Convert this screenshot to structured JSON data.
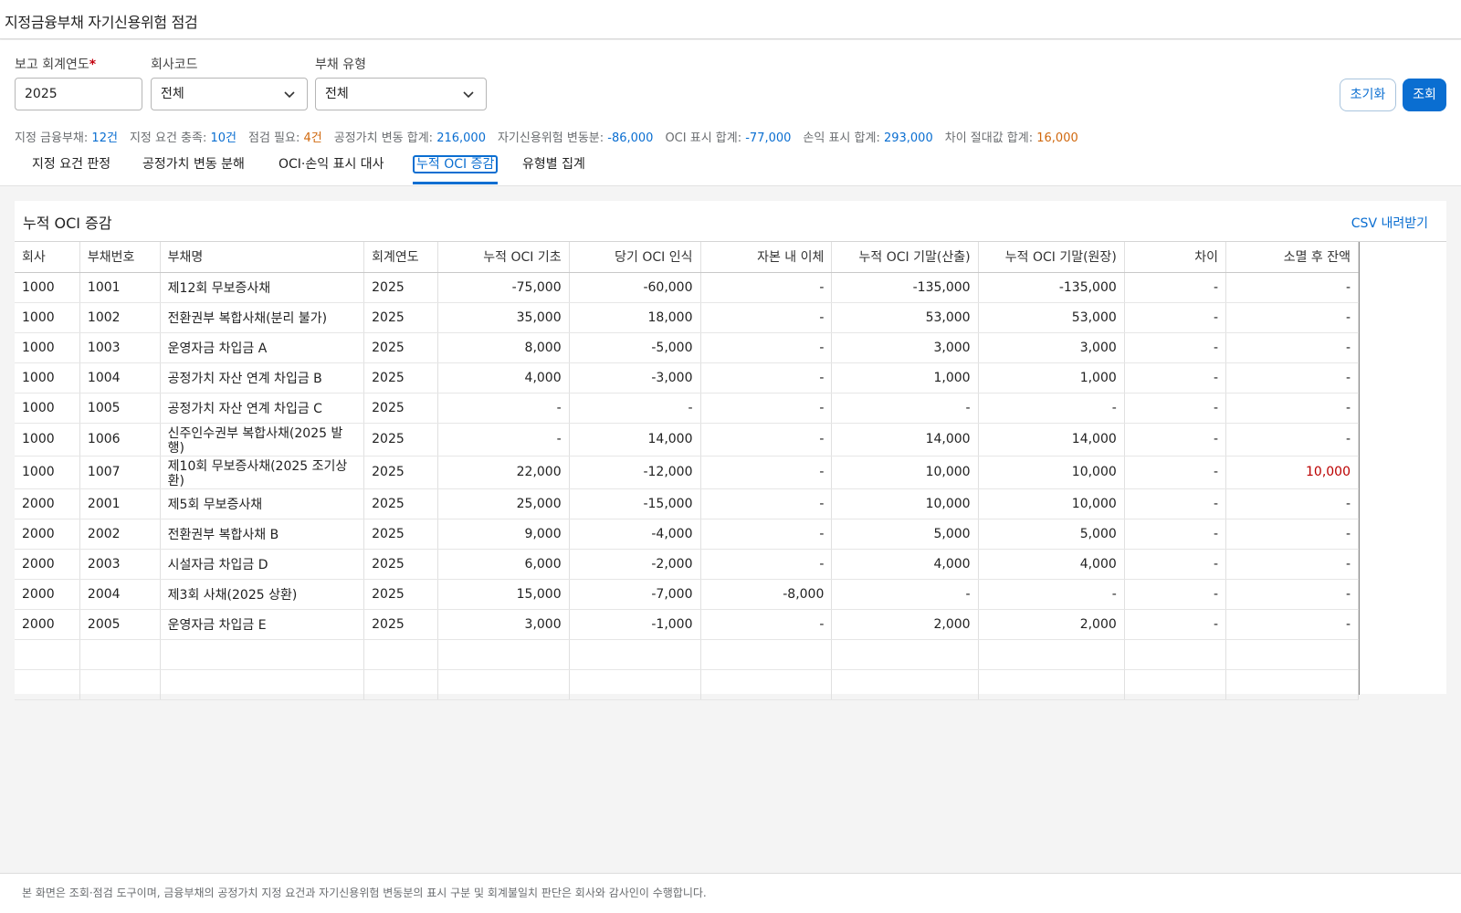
{
  "app": {
    "title": "지정금융부채 자기신용위험 점검"
  },
  "filters": {
    "year": {
      "label": "보고 회계연도",
      "required_mark": "*",
      "value": "2025"
    },
    "company": {
      "label": "회사코드",
      "value": "전체"
    },
    "liability_type": {
      "label": "부채 유형",
      "value": "전체"
    }
  },
  "buttons": {
    "reset": "초기화",
    "search": "조회"
  },
  "summary": [
    {
      "label": "지정 금융부채:",
      "value": "12건",
      "color": "blue"
    },
    {
      "label": "지정 요건 충족:",
      "value": "10건",
      "color": "blue"
    },
    {
      "label": "점검 필요:",
      "value": "4건",
      "color": "orange"
    },
    {
      "label": "공정가치 변동 합계:",
      "value": "216,000",
      "color": "blue"
    },
    {
      "label": "자기신용위험 변동분:",
      "value": "-86,000",
      "color": "blue"
    },
    {
      "label": "OCI 표시 합계:",
      "value": "-77,000",
      "color": "blue"
    },
    {
      "label": "손익 표시 합계:",
      "value": "293,000",
      "color": "blue"
    },
    {
      "label": "차이 절대값 합계:",
      "value": "16,000",
      "color": "orange"
    }
  ],
  "tabs": [
    {
      "label": "지정 요건 판정",
      "active": false
    },
    {
      "label": "공정가치 변동 분해",
      "active": false
    },
    {
      "label": "OCI·손익 표시 대사",
      "active": false
    },
    {
      "label": "누적 OCI 증감",
      "active": true
    },
    {
      "label": "유형별 집계",
      "active": false
    }
  ],
  "panel": {
    "title": "누적 OCI 증감",
    "csv_label": "CSV 내려받기"
  },
  "table": {
    "columns": [
      "회사",
      "부채번호",
      "부채명",
      "회계연도",
      "누적 OCI 기초",
      "당기 OCI 인식",
      "자본 내 이체",
      "누적 OCI 기말(산출)",
      "누적 OCI 기말(원장)",
      "차이",
      "소멸 후 잔액"
    ],
    "rows": [
      [
        "1000",
        "1001",
        "제12회 무보증사채",
        "2025",
        "-75,000",
        "-60,000",
        "-",
        "-135,000",
        "-135,000",
        "-",
        "-"
      ],
      [
        "1000",
        "1002",
        "전환권부 복합사채(분리 불가)",
        "2025",
        "35,000",
        "18,000",
        "-",
        "53,000",
        "53,000",
        "-",
        "-"
      ],
      [
        "1000",
        "1003",
        "운영자금 차입금 A",
        "2025",
        "8,000",
        "-5,000",
        "-",
        "3,000",
        "3,000",
        "-",
        "-"
      ],
      [
        "1000",
        "1004",
        "공정가치 자산 연계 차입금 B",
        "2025",
        "4,000",
        "-3,000",
        "-",
        "1,000",
        "1,000",
        "-",
        "-"
      ],
      [
        "1000",
        "1005",
        "공정가치 자산 연계 차입금 C",
        "2025",
        "-",
        "-",
        "-",
        "-",
        "-",
        "-",
        "-"
      ],
      [
        "1000",
        "1006",
        "신주인수권부 복합사채(2025 발행)",
        "2025",
        "-",
        "14,000",
        "-",
        "14,000",
        "14,000",
        "-",
        "-"
      ],
      [
        "1000",
        "1007",
        "제10회 무보증사채(2025 조기상환)",
        "2025",
        "22,000",
        "-12,000",
        "-",
        "10,000",
        "10,000",
        "-",
        "10,000"
      ],
      [
        "2000",
        "2001",
        "제5회 무보증사채",
        "2025",
        "25,000",
        "-15,000",
        "-",
        "10,000",
        "10,000",
        "-",
        "-"
      ],
      [
        "2000",
        "2002",
        "전환권부 복합사채 B",
        "2025",
        "9,000",
        "-4,000",
        "-",
        "5,000",
        "5,000",
        "-",
        "-"
      ],
      [
        "2000",
        "2003",
        "시설자금 차입금 D",
        "2025",
        "6,000",
        "-2,000",
        "-",
        "4,000",
        "4,000",
        "-",
        "-"
      ],
      [
        "2000",
        "2004",
        "제3회 사채(2025 상환)",
        "2025",
        "15,000",
        "-7,000",
        "-8,000",
        "-",
        "-",
        "-",
        "-"
      ],
      [
        "2000",
        "2005",
        "운영자금 차입금 E",
        "2025",
        "3,000",
        "-1,000",
        "-",
        "2,000",
        "2,000",
        "-",
        "-"
      ]
    ],
    "highlight": {
      "row": 6,
      "col": 10,
      "color": "#bb0000"
    }
  },
  "footer": {
    "note": "본 화면은 조회·점검 도구이며, 금융부채의 공정가치 지정 요건과 자기신용위험 변동분의 표시 구분 및 회계불일치 판단은 회사와 감사인이 수행합니다."
  }
}
